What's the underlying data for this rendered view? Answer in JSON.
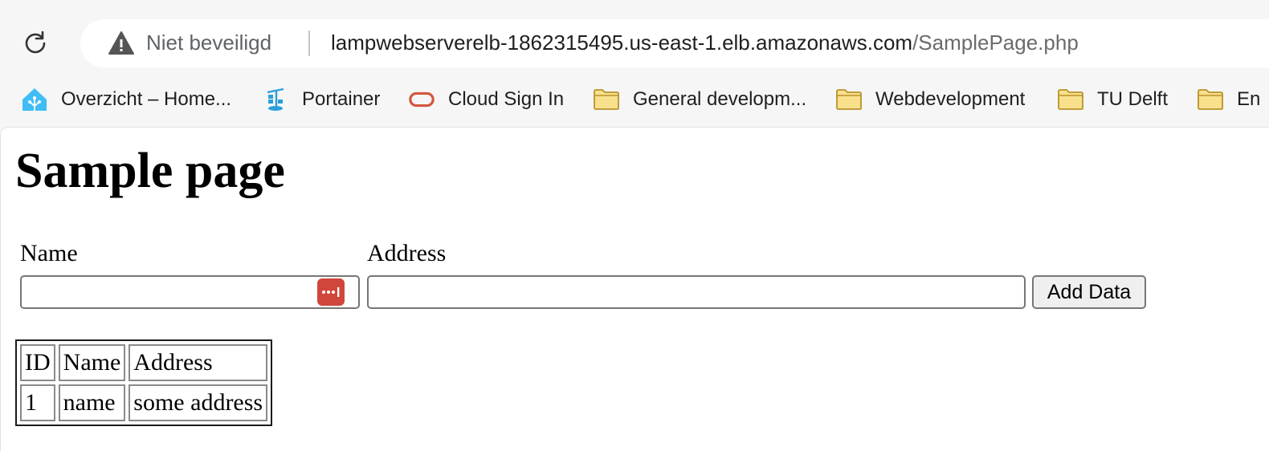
{
  "browser": {
    "security_label": "Niet beveiligd",
    "url_host": "lampwebserverelb-1862315495.us-east-1.elb.amazonaws.com",
    "url_path": "/SamplePage.php"
  },
  "bookmarks": [
    {
      "label": "Overzicht – Home...",
      "icon": "home-assistant-icon"
    },
    {
      "label": "Portainer",
      "icon": "portainer-icon"
    },
    {
      "label": "Cloud Sign In",
      "icon": "oracle-cloud-icon"
    },
    {
      "label": "General developm...",
      "icon": "folder-icon"
    },
    {
      "label": "Webdevelopment",
      "icon": "folder-icon"
    },
    {
      "label": "TU Delft",
      "icon": "folder-icon"
    },
    {
      "label": "En",
      "icon": "folder-icon"
    }
  ],
  "page": {
    "title": "Sample page",
    "form": {
      "name_label": "Name",
      "name_value": "",
      "address_label": "Address",
      "address_value": "",
      "submit_label": "Add Data"
    },
    "table": {
      "headers": [
        "ID",
        "Name",
        "Address"
      ],
      "rows": [
        [
          "1",
          "name",
          "some address"
        ]
      ]
    }
  },
  "colors": {
    "password_manager_badge": "#d0463b",
    "folder_fill": "#f9e08d",
    "folder_stroke": "#b8932a",
    "oracle_red": "#d4563f",
    "home_assistant_blue": "#41bdf5"
  }
}
